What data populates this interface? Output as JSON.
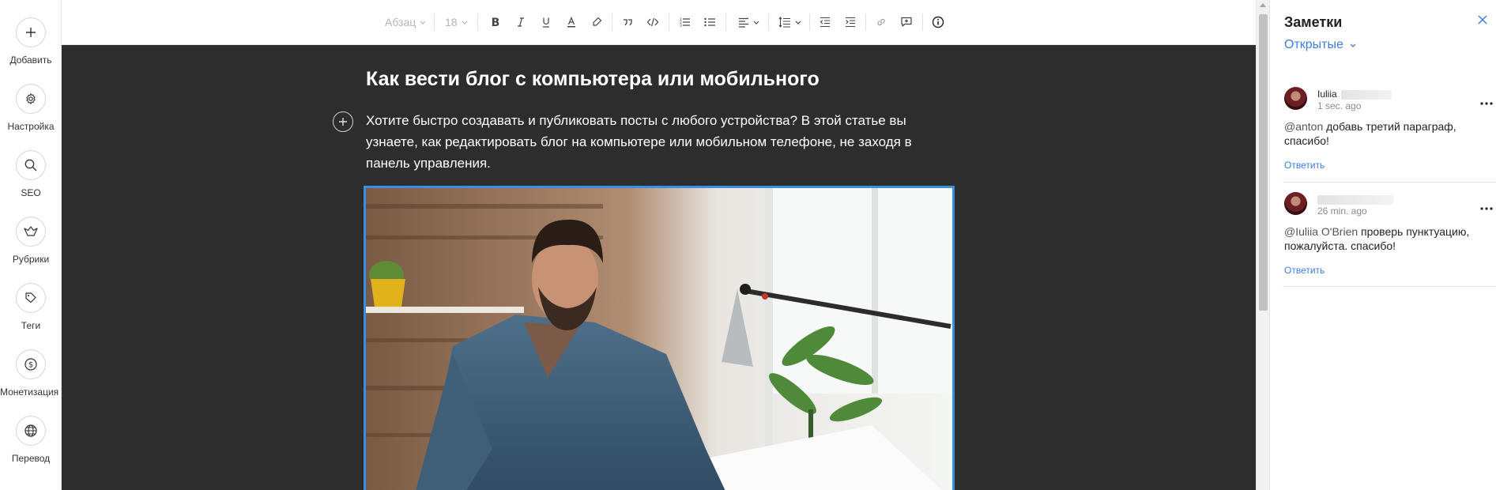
{
  "sidebar": {
    "items": [
      {
        "label": "Добавить",
        "icon": "plus-icon"
      },
      {
        "label": "Настройка",
        "icon": "gear-icon"
      },
      {
        "label": "SEO",
        "icon": "search-icon"
      },
      {
        "label": "Рубрики",
        "icon": "categories-icon"
      },
      {
        "label": "Теги",
        "icon": "tag-icon"
      },
      {
        "label": "Монетизация",
        "icon": "dollar-icon"
      },
      {
        "label": "Перевод",
        "icon": "globe-icon"
      }
    ]
  },
  "toolbar": {
    "paragraph_style": "Абзац",
    "font_size": "18"
  },
  "post": {
    "title": "Как вести блог с компьютера или мобильного",
    "paragraph": "Хотите быстро создавать и публиковать посты с любого устройства? В этой статье вы узнаете, как редактировать блог на компьютере или мобильном телефоне, не заходя в панель управления."
  },
  "notes": {
    "title": "Заметки",
    "filter": "Открытые",
    "items": [
      {
        "author": "Iuliia",
        "time": "1 sec. ago",
        "mention": "@anton",
        "text": " добавь третий параграф, спасибо!",
        "reply": "Ответить"
      },
      {
        "author": "",
        "time": "26 min. ago",
        "mention": "@Iuliia O'Brien",
        "text": " проверь пунктуацию, пожалуйста. спасибо!",
        "reply": "Ответить"
      }
    ]
  },
  "colors": {
    "accent": "#3b7fe0",
    "canvas": "#2d2d2d",
    "selection": "#3b8ee6"
  }
}
